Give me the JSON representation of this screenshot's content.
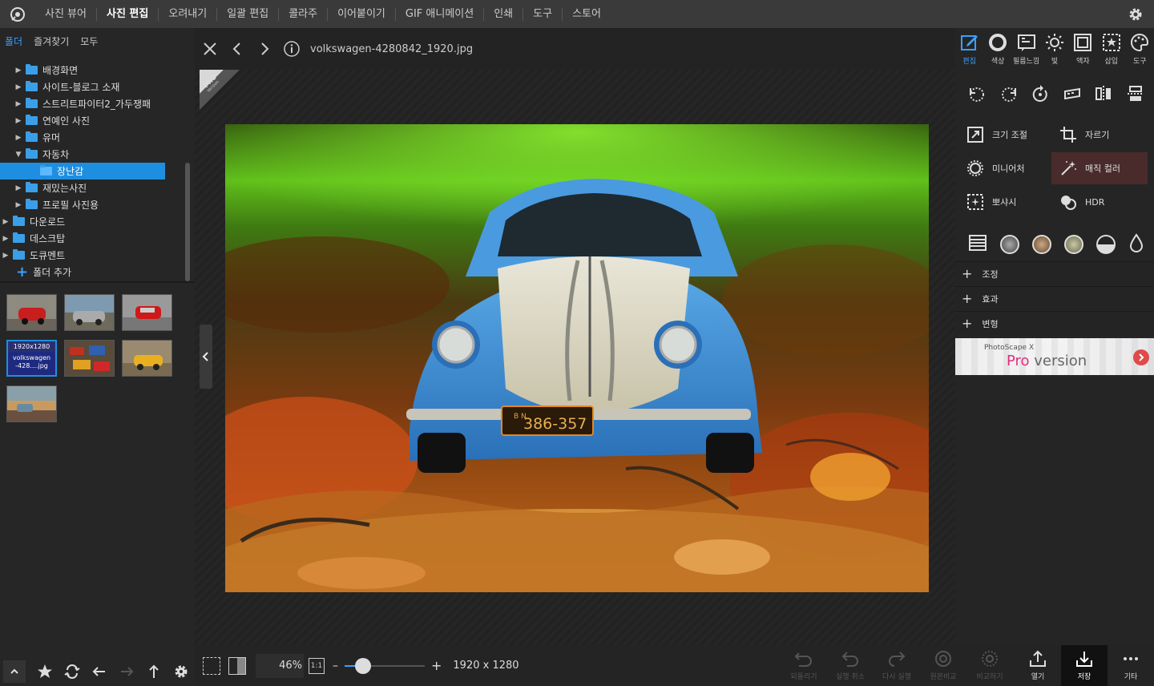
{
  "menu": {
    "items": [
      "사진 뷰어",
      "사진 편집",
      "오려내기",
      "일괄 편집",
      "콜라주",
      "이어붙이기",
      "GIF 애니메이션",
      "인쇄",
      "도구",
      "스토어"
    ],
    "active_index": 1
  },
  "browser": {
    "tabs": [
      "폴더",
      "즐겨찾기",
      "모두"
    ],
    "active_tab": 0,
    "tree": [
      {
        "label": "배경화면",
        "expanded": false,
        "level": 1
      },
      {
        "label": "사이트-블로그 소재",
        "expanded": false,
        "level": 1
      },
      {
        "label": "스트리트파이터2_가두쟁패",
        "expanded": false,
        "level": 1
      },
      {
        "label": "연예인 사진",
        "expanded": false,
        "level": 1
      },
      {
        "label": "유머",
        "expanded": false,
        "level": 1
      },
      {
        "label": "자동차",
        "expanded": true,
        "level": 1
      },
      {
        "label": "장난감",
        "expanded": false,
        "level": 2,
        "selected": true
      },
      {
        "label": "재밌는사진",
        "expanded": false,
        "level": 1
      },
      {
        "label": "프로필 사진용",
        "expanded": false,
        "level": 1
      },
      {
        "label": "다운로드",
        "expanded": false,
        "level": 0
      },
      {
        "label": "데스크탑",
        "expanded": false,
        "level": 0
      },
      {
        "label": "도큐멘트",
        "expanded": false,
        "level": 0
      }
    ],
    "add_folder": "폴더 추가",
    "selected_thumb": {
      "resolution": "1920x1280",
      "name": "volkswagen\n-428....jpg"
    }
  },
  "viewer": {
    "filename": "volkswagen-4280842_1920.jpg",
    "pro_badge": "PRO",
    "pro_badge_sub": "Version",
    "zoom": "46%",
    "one_to_one": "1:1",
    "dimensions": "1920 x 1280",
    "zoom_slider_value": 0.16,
    "plate": "386-357",
    "plate_prefix": "B N"
  },
  "tools": {
    "tabs": [
      "편집",
      "색상",
      "필름느낌",
      "빛",
      "액자",
      "삽입",
      "도구"
    ],
    "active_tab": 0,
    "features": [
      "크기 조절",
      "자르기",
      "미니어처",
      "매직 컬러",
      "뽀샤시",
      "HDR"
    ],
    "sections": [
      "조정",
      "효과",
      "변형"
    ],
    "ad_title": "PhotoScape X",
    "ad_text_pro": "Pro",
    "ad_text_version": " version"
  },
  "bottom": {
    "undo_all": "되돌리기",
    "undo": "실행 취소",
    "redo": "다시 실행",
    "original": "원본비교",
    "compare": "비교하기",
    "open": "열기",
    "save": "저장",
    "more": "기타"
  },
  "colors": {
    "accent": "#3aa0ff",
    "selection": "#1e8ee0"
  }
}
